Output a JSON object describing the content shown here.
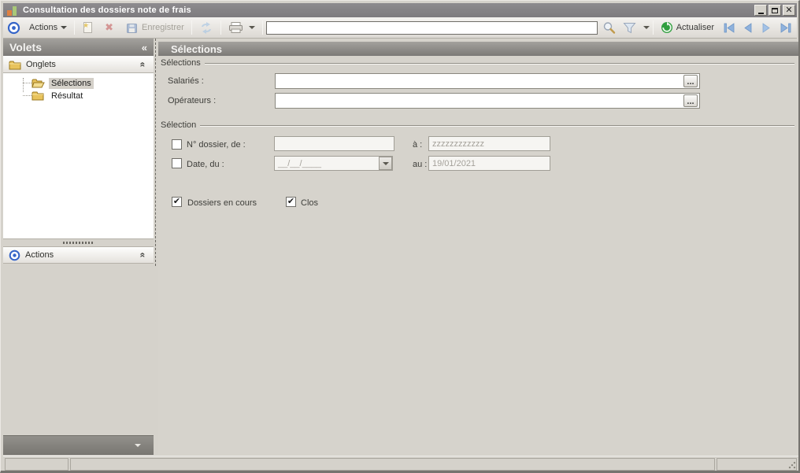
{
  "window": {
    "title": "Consultation des dossiers note de frais"
  },
  "toolbar": {
    "actions_label": "Actions",
    "save_label": "Enregistrer",
    "search_value": "",
    "refresh_label": "Actualiser"
  },
  "icons": {
    "collapse_left": "«",
    "section_collapse": "«",
    "ellipsis": "...",
    "check": "✔",
    "unchecked": ""
  },
  "sidebar": {
    "title": "Volets",
    "onglets_label": "Onglets",
    "tree": {
      "items": [
        {
          "label": "Sélections"
        },
        {
          "label": "Résultat"
        }
      ]
    },
    "actions_label": "Actions"
  },
  "main": {
    "header": "Sélections",
    "group_selections": {
      "label": "Sélections",
      "salaries_label": "Salariés :",
      "salaries_value": "",
      "operateurs_label": "Opérateurs :",
      "operateurs_value": ""
    },
    "group_selection": {
      "label": "Sélection",
      "dossier_label": "N° dossier, de :",
      "dossier_from_value": "",
      "dossier_to_label": "à :",
      "dossier_to_value": "zzzzzzzzzzzz",
      "date_label": "Date, du :",
      "date_from_value": "__/__/____",
      "date_to_label": "au :",
      "date_to_value": "19/01/2021",
      "encours_label": "Dossiers en cours",
      "clos_label": "Clos"
    }
  },
  "statusbar": {
    "cell1": "",
    "cell2": "",
    "cell3": ""
  },
  "colors": {
    "accent_blue": "#3565c8",
    "arrow_blue": "#8fb2dd",
    "refresh_green": "#2f9e3e",
    "folder_gold": "#e8c35c"
  }
}
